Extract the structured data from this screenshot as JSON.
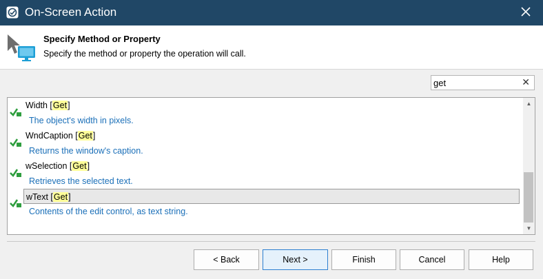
{
  "window": {
    "title": "On-Screen Action",
    "close_icon": "close-icon",
    "app_icon": "app-logo-icon",
    "title_bar_color": "#204766"
  },
  "header": {
    "title": "Specify Method or Property",
    "subtitle": "Specify the method or property the operation will call.",
    "icon": "cursor-monitor-icon"
  },
  "search": {
    "value": "get",
    "clear_icon": "clear-icon"
  },
  "items": [
    {
      "name": "Width",
      "tag": "Get",
      "description": "The object's width in pixels.",
      "selected": false,
      "icon": "property-icon"
    },
    {
      "name": "WndCaption",
      "tag": "Get",
      "description": "Returns the window's caption.",
      "selected": false,
      "icon": "property-icon"
    },
    {
      "name": "wSelection",
      "tag": "Get",
      "description": "Retrieves the selected text.",
      "selected": false,
      "icon": "property-icon"
    },
    {
      "name": "wText",
      "tag": "Get",
      "description": "Contents of the edit control, as text string.",
      "selected": true,
      "icon": "property-icon"
    }
  ],
  "buttons": {
    "back": "< Back",
    "next": "Next >",
    "finish": "Finish",
    "cancel": "Cancel",
    "help": "Help"
  }
}
